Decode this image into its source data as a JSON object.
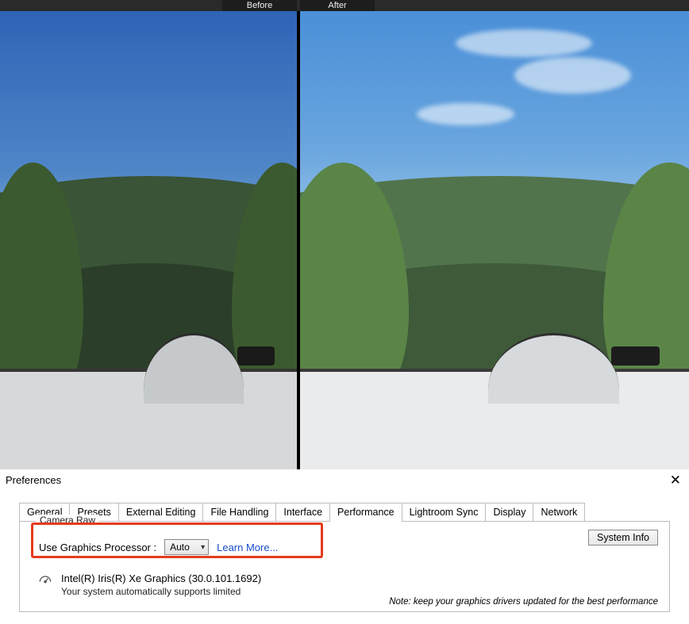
{
  "compare": {
    "before_label": "Before",
    "after_label": "After"
  },
  "prefs": {
    "title": "Preferences",
    "close_glyph": "✕",
    "fieldset_caption": "Camera Raw",
    "tabs": [
      {
        "label": "General"
      },
      {
        "label": "Presets"
      },
      {
        "label": "External Editing"
      },
      {
        "label": "File Handling"
      },
      {
        "label": "Interface"
      },
      {
        "label": "Performance"
      },
      {
        "label": "Lightroom Sync"
      },
      {
        "label": "Display"
      },
      {
        "label": "Network"
      }
    ],
    "active_tab_index": 5,
    "gpu": {
      "label": "Use Graphics Processor :",
      "selected": "Auto",
      "learn_more": "Learn More...",
      "system_info_button": "System Info",
      "device_line": "Intel(R) Iris(R) Xe Graphics (30.0.101.1692)",
      "support_line": "Your system automatically supports limited",
      "note": "Note: keep your graphics drivers updated for the best performance"
    }
  }
}
